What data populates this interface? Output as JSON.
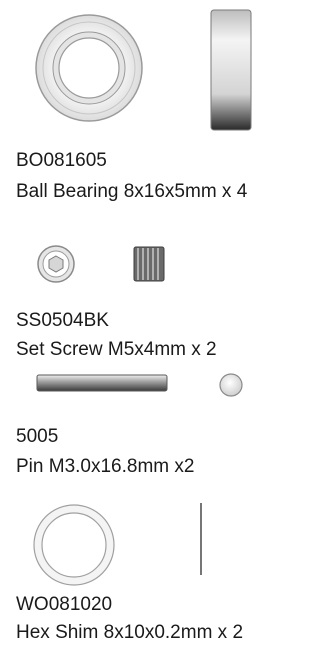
{
  "parts": [
    {
      "code": "BO081605",
      "description": "Ball Bearing 8x16x5mm x 4"
    },
    {
      "code": "SS0504BK",
      "description": "Set Screw M5x4mm x 2"
    },
    {
      "code": "5005",
      "description": "Pin M3.0x16.8mm x2"
    },
    {
      "code": "WO081020",
      "description": "Hex Shim 8x10x0.2mm x 2"
    }
  ],
  "colors": {
    "text": "#1a1a1a",
    "outline": "#8a8a8a",
    "fill_light": "#f2f2f2",
    "fill_dark": "#5a5a5a"
  }
}
